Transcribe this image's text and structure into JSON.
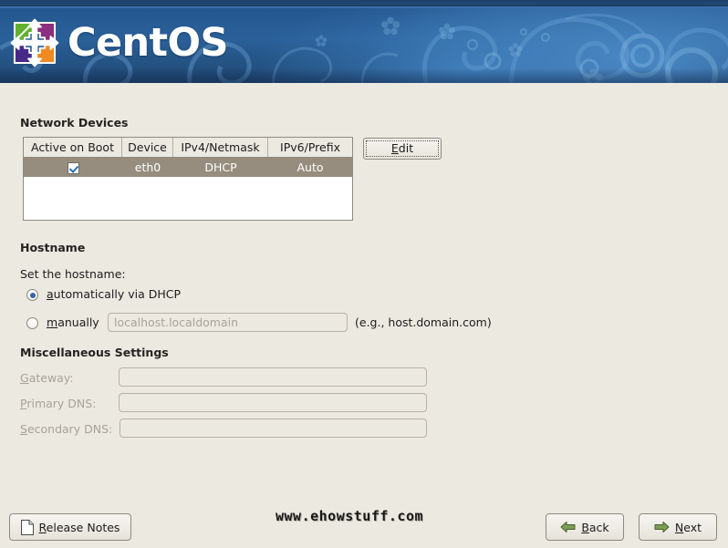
{
  "banner": {
    "product_name": "CentOS",
    "logo_icon": "centos-swirl-logo"
  },
  "network_devices": {
    "section_title": "Network Devices",
    "columns": [
      "Active on Boot",
      "Device",
      "IPv4/Netmask",
      "IPv6/Prefix"
    ],
    "rows": [
      {
        "active_on_boot": true,
        "device": "eth0",
        "ipv4_netmask": "DHCP",
        "ipv6_prefix": "Auto",
        "selected": true
      }
    ],
    "edit_button": {
      "label": "Edit",
      "mnemonic": "E",
      "focused": true
    }
  },
  "hostname": {
    "section_title": "Hostname",
    "prompt": "Set the hostname:",
    "options": [
      {
        "label_pre": "",
        "mnemonic": "a",
        "label_post": "utomatically via DHCP",
        "selected": true
      },
      {
        "label_pre": "",
        "mnemonic": "m",
        "label_post": "anually",
        "selected": false
      }
    ],
    "manual_input": {
      "value": "",
      "placeholder": "localhost.localdomain",
      "disabled": true
    },
    "example_hint": "(e.g., host.domain.com)"
  },
  "misc": {
    "section_title": "Miscellaneous Settings",
    "fields": [
      {
        "mnemonic": "G",
        "label_post": "ateway:",
        "value": "",
        "disabled": true
      },
      {
        "mnemonic": "P",
        "label_post": "rimary DNS:",
        "value": "",
        "disabled": true
      },
      {
        "mnemonic": "S",
        "label_post": "econdary DNS:",
        "value": "",
        "disabled": true
      }
    ]
  },
  "footer": {
    "release_notes": {
      "label_pre": "",
      "mnemonic": "R",
      "label_post": "elease Notes",
      "icon": "document-icon"
    },
    "watermark": "www.ehowstuff.com",
    "back": {
      "mnemonic": "B",
      "label_post": "ack",
      "icon": "arrow-left-icon"
    },
    "next": {
      "label_pre": "N",
      "mnemonic": "N",
      "label_post": "ext",
      "icon": "arrow-right-icon"
    }
  },
  "colors": {
    "banner_blue": "#2a6099",
    "body_beige": "#ece9e1",
    "row_selected": "#968d7e",
    "accent_blue": "#3465a4",
    "arrow_green": "#6f8f4a"
  }
}
